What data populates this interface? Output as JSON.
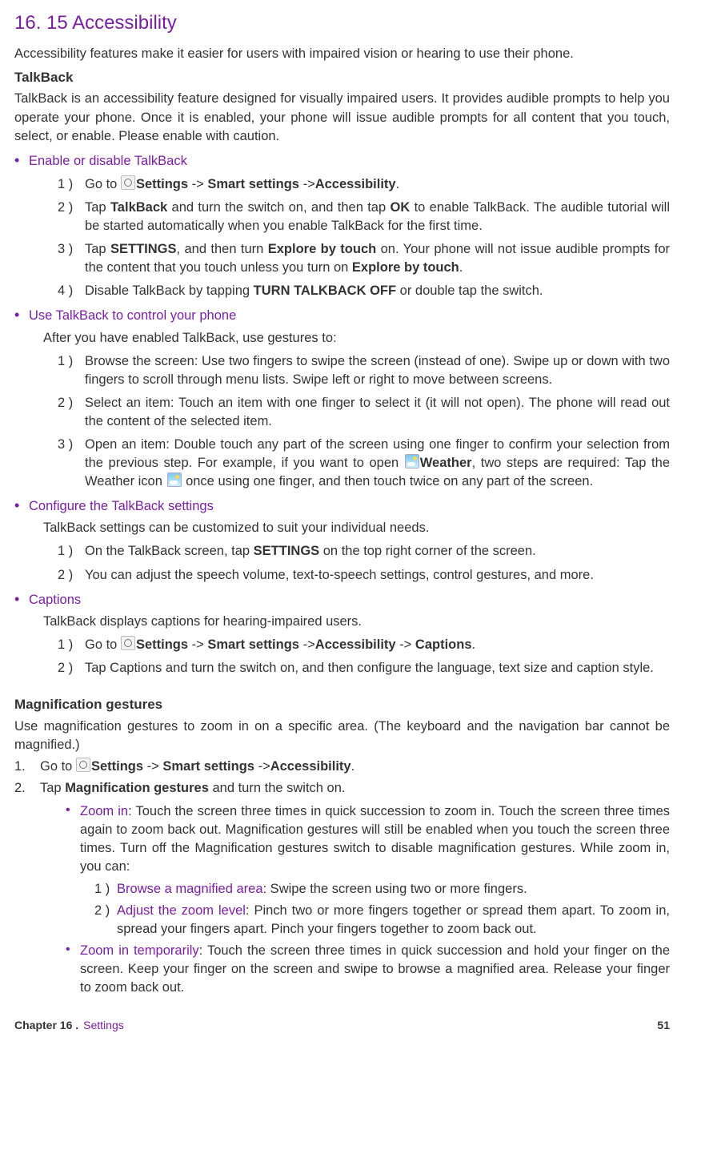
{
  "title": "16. 15  Accessibility",
  "intro": "Accessibility features make it easier for users with impaired vision or hearing to use their phone.",
  "talkback_h": "TalkBack",
  "talkback_p": "TalkBack is an accessibility feature designed for visually impaired users. It provides audible prompts to help you operate your phone. Once it is enabled, your phone will issue audible prompts for all content that you touch, select, or enable. Please enable with caution.",
  "s1": {
    "h": "Enable or disable TalkBack",
    "items": [
      {
        "n": "1 )",
        "pre": "Go to ",
        "path": [
          "Settings",
          " -> ",
          "Smart settings",
          " ->",
          "Accessibility"
        ],
        "post": "."
      },
      {
        "n": "2 )",
        "text_a": "Tap ",
        "b1": "TalkBack",
        "text_b": " and turn the switch on, and then tap ",
        "b2": "OK",
        "text_c": " to enable TalkBack. The audible tutorial will be started automatically when you enable TalkBack for the first time."
      },
      {
        "n": "3 )",
        "text_a": "Tap ",
        "b1": "SETTINGS",
        "text_b": ", and then turn ",
        "b2": "Explore by touch",
        "text_c": " on. Your phone will not issue audible prompts for the content that you touch unless you turn on ",
        "b3": "Explore by touch",
        "text_d": "."
      },
      {
        "n": "4 )",
        "text_a": "Disable TalkBack by tapping ",
        "b1": "TURN TALKBACK OFF",
        "text_b": " or double tap the switch."
      }
    ]
  },
  "s2": {
    "h": "Use TalkBack to control your phone",
    "after": "After you have enabled TalkBack, use gestures to:",
    "items": [
      {
        "n": "1 )",
        "text": "Browse the screen: Use two fingers to swipe the screen (instead of one). Swipe up or down with two fingers to scroll through menu lists. Swipe left or right to move between screens."
      },
      {
        "n": "2 )",
        "text": "Select an item: Touch an item with one finger to select it (it will not open). The phone will read out the content of the selected item."
      },
      {
        "n": "3 )",
        "text_a": "Open an item: Double touch any part of the screen using one finger to confirm your selection from the previous step. For example, if you want to open ",
        "b1": "Weather",
        "text_b": ", two steps are required: Tap the Weather icon ",
        "text_c": " once using one finger, and then touch twice on any part of the screen."
      }
    ]
  },
  "s3": {
    "h": "Configure the TalkBack settings",
    "after": "TalkBack settings can be customized to suit your individual needs.",
    "items": [
      {
        "n": "1 )",
        "text_a": "On the TalkBack screen, tap ",
        "b1": "SETTINGS",
        "text_b": " on the top right corner of the screen."
      },
      {
        "n": "2 )",
        "text": "You can adjust the speech volume, text-to-speech settings, control gestures, and more."
      }
    ]
  },
  "s4": {
    "h": "Captions",
    "after": "TalkBack displays captions for hearing-impaired users.",
    "items": [
      {
        "n": "1 )",
        "pre": "Go to ",
        "path": [
          "Settings",
          " -> ",
          "Smart settings",
          " ->",
          "Accessibility",
          " -> ",
          "Captions"
        ],
        "post": "."
      },
      {
        "n": "2 )",
        "text": "Tap Captions and turn the switch on, and then configure the language, text size and caption style."
      }
    ]
  },
  "mag_h": "Magnification gestures",
  "mag_p": "Use magnification gestures to zoom in on a specific area. (The keyboard and the navigation bar cannot be magnified.)",
  "mag_steps": [
    {
      "n": "1.",
      "pre": "Go to ",
      "path": [
        "Settings",
        " -> ",
        "Smart settings",
        " ->",
        "Accessibility"
      ],
      "post": "."
    },
    {
      "n": "2.",
      "text_a": "Tap ",
      "b1": "Magnification gestures",
      "text_b": " and turn the switch on."
    }
  ],
  "zoom_in_label": "Zoom in",
  "zoom_in_text": ": Touch the screen three times in quick succession to zoom in. Touch the screen three times again to zoom back out. Magnification gestures will still be enabled when you touch the screen three times. Turn off the Magnification gestures switch to disable magnification gestures. While zoom in, you can:",
  "zoom_sub": [
    {
      "n": "1 ) ",
      "label": "Browse a magnified area",
      "text": ": Swipe the screen using two or more fingers."
    },
    {
      "n": "2 ) ",
      "label": "Adjust the zoom level",
      "text": ": Pinch two or more fingers together or spread them apart. To zoom in, spread your fingers apart. Pinch your fingers together to zoom back out."
    }
  ],
  "zoom_temp_label": "Zoom in temporarily",
  "zoom_temp_text": ": Touch the screen three times in quick succession and hold your finger on the screen. Keep your finger on the screen and swipe to browse a magnified area. Release your finger to zoom back out.",
  "footer": {
    "chap": "Chapter 16 .",
    "sec": "Settings",
    "page": "51"
  }
}
